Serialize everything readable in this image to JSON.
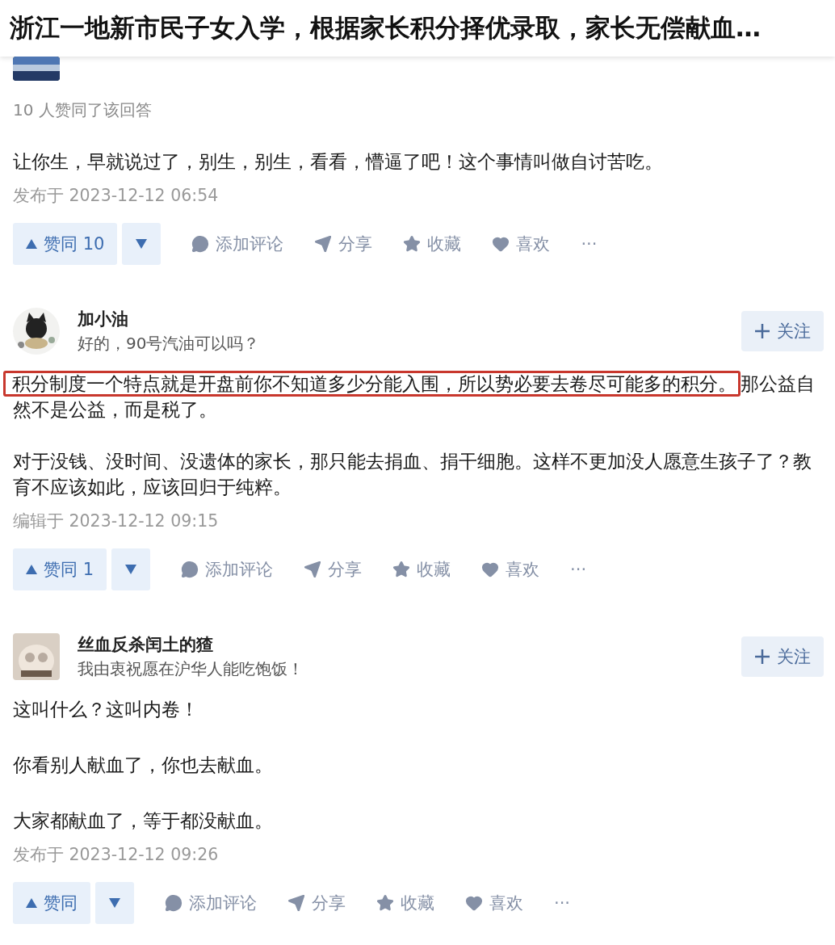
{
  "title": "浙江一地新市民子女入学，根据家长积分择优录取，家长无偿献血…",
  "answers": [
    {
      "avatar": {
        "kind": "picture"
      },
      "upvote_summary": "10 人赞同了该回答",
      "paragraphs": [
        {
          "text": "让你生，早就说过了，别生，别生，看看，懵逼了吧！这个事情叫做自讨苦吃。"
        }
      ],
      "timestamp": "发布于 2023-12-12 06:54",
      "actions": {
        "upvote": "赞同 10",
        "comment": "添加评论",
        "share": "分享",
        "favorite": "收藏",
        "like": "喜欢",
        "more": "···"
      }
    },
    {
      "author": "加小油",
      "bio": "好的，90号汽油可以吗？",
      "avatar": {
        "kind": "picture"
      },
      "follow": "关注",
      "paragraphs": [
        {
          "highlight": "积分制度一个特点就是开盘前你不知道多少分能入围，所以势必要去卷尽可能多的积分。",
          "text": "那公益自然不是公益，而是税了。"
        },
        {
          "text": "对于没钱、没时间、没遗体的家长，那只能去捐血、捐干细胞。这样不更加没人愿意生孩子了？教育不应该如此，应该回归于纯粹。"
        }
      ],
      "timestamp": "编辑于 2023-12-12 09:15",
      "actions": {
        "upvote": "赞同 1",
        "comment": "添加评论",
        "share": "分享",
        "favorite": "收藏",
        "like": "喜欢",
        "more": "···"
      }
    },
    {
      "author": "丝血反杀闰土的猹",
      "bio": "我由衷祝愿在沪华人能吃饱饭！",
      "avatar": {
        "kind": "picture"
      },
      "follow": "关注",
      "paragraphs": [
        {
          "text": "这叫什么？这叫内卷！"
        },
        {
          "text": "你看别人献血了，你也去献血。"
        },
        {
          "text": "大家都献血了，等于都没献血。"
        }
      ],
      "timestamp": "发布于 2023-12-12 09:26",
      "actions": {
        "upvote": "赞同",
        "comment": "添加评论",
        "share": "分享",
        "favorite": "收藏",
        "like": "喜欢",
        "more": "···"
      }
    }
  ]
}
